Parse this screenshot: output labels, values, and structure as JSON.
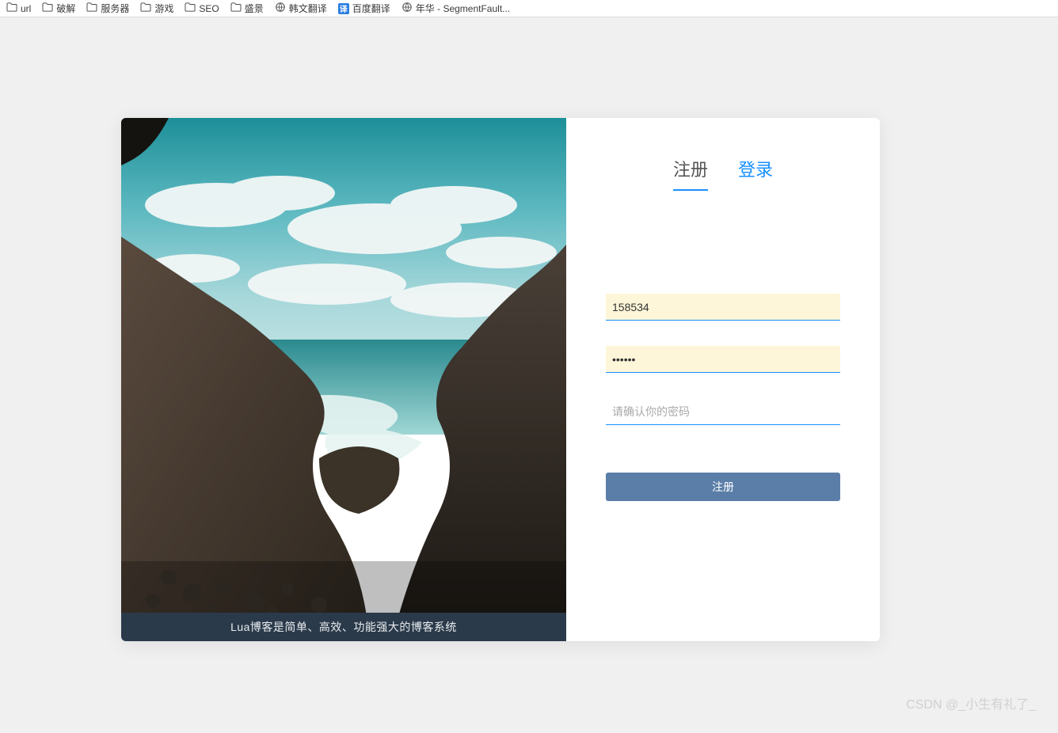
{
  "bookmarks": [
    {
      "icon": "folder",
      "label": "url"
    },
    {
      "icon": "folder",
      "label": "破解"
    },
    {
      "icon": "folder",
      "label": "服务器"
    },
    {
      "icon": "folder",
      "label": "游戏"
    },
    {
      "icon": "folder",
      "label": "SEO"
    },
    {
      "icon": "folder",
      "label": "盛景"
    },
    {
      "icon": "globe",
      "label": "韩文翻译"
    },
    {
      "icon": "square",
      "label": "百度翻译",
      "badge": "译"
    },
    {
      "icon": "globe",
      "label": "年华 - SegmentFault..."
    }
  ],
  "left_caption": "Lua博客是简单、高效、功能强大的博客系统",
  "tabs": {
    "register": "注册",
    "login": "登录"
  },
  "form": {
    "username_value": "158534",
    "password_value": "••••••",
    "confirm_placeholder": "请确认你的密码",
    "submit_label": "注册"
  },
  "watermark": "CSDN @_小生有礼了_"
}
